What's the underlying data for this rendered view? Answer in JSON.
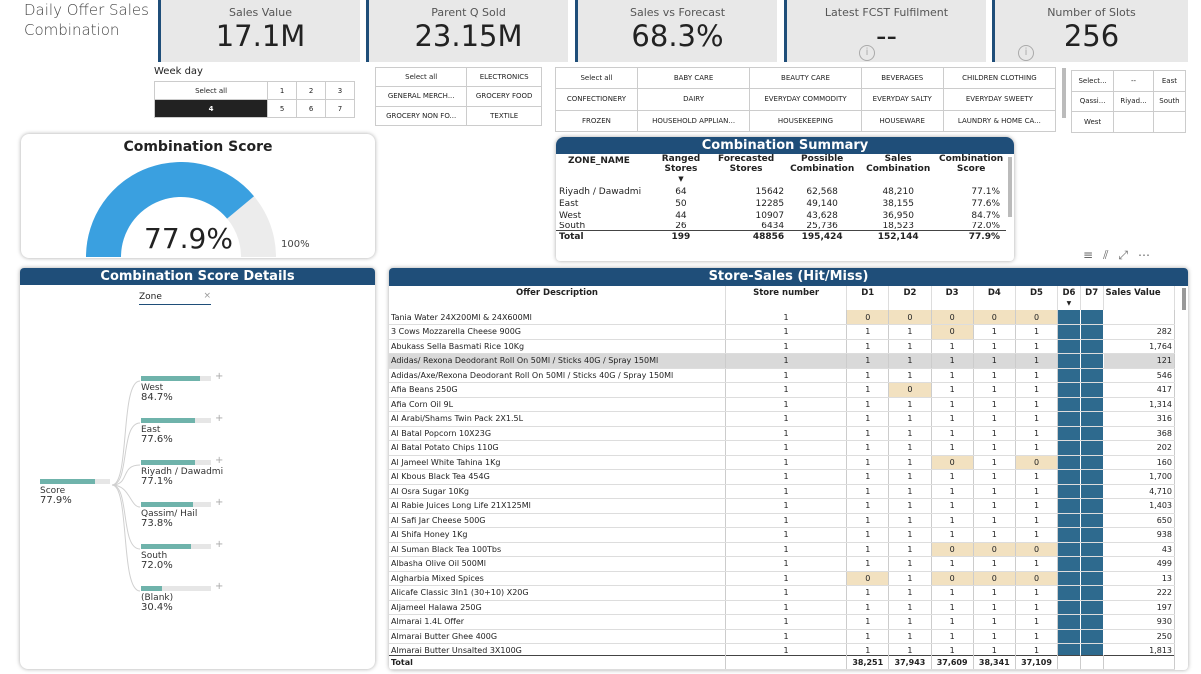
{
  "page": {
    "title": "Daily Offer Sales Combination"
  },
  "kpis": [
    {
      "label": "Sales Value",
      "value": "17.1M"
    },
    {
      "label": "Parent Q Sold",
      "value": "23.15M"
    },
    {
      "label": "Sales vs Forecast",
      "value": "68.3%"
    },
    {
      "label": "Latest FCST Fulfilment",
      "value": "--"
    },
    {
      "label": "Number of Slots",
      "value": "256"
    }
  ],
  "weekday": {
    "label": "Week day",
    "row1": [
      "Select all",
      "1",
      "2",
      "3"
    ],
    "row2": [
      "4",
      "5",
      "6",
      "7"
    ]
  },
  "dept": {
    "rows": [
      [
        "Select all",
        "ELECTRONICS"
      ],
      [
        "GENERAL MERCH...",
        "GROCERY FOOD"
      ],
      [
        "GROCERY NON FO...",
        "TEXTILE"
      ]
    ]
  },
  "category": {
    "rows": [
      [
        "Select all",
        "BABY CARE",
        "BEAUTY CARE",
        "BEVERAGES",
        "CHILDREN CLOTHING"
      ],
      [
        "CONFECTIONERY",
        "DAIRY",
        "EVERYDAY COMMODITY",
        "EVERYDAY SALTY",
        "EVERYDAY SWEETY"
      ],
      [
        "FROZEN",
        "HOUSEHOLD APPLIAN...",
        "HOUSEKEEPING",
        "HOUSEWARE",
        "LAUNDRY & HOME CA..."
      ]
    ]
  },
  "zone_slicer": {
    "rows": [
      [
        "Select...",
        "--",
        "East"
      ],
      [
        "Qassi...",
        "Riyad...",
        "South"
      ],
      [
        "West",
        "",
        ""
      ]
    ]
  },
  "gauge": {
    "title": "Combination Score",
    "value": "77.9%",
    "max_label": "100%",
    "fraction": 0.779,
    "fill": "#3aa0e0",
    "track": "#ececec"
  },
  "summary": {
    "title": "Combination Summary",
    "headers": [
      "ZONE_NAME",
      "Ranged Stores",
      "Forecasted Stores",
      "Possible Combination",
      "Sales Combination",
      "Combination Score"
    ],
    "rows": [
      [
        "Riyadh / Dawadmi",
        "64",
        "15642",
        "62,568",
        "48,210",
        "77.1%"
      ],
      [
        "East",
        "50",
        "12285",
        "49,140",
        "38,155",
        "77.6%"
      ],
      [
        "West",
        "44",
        "10907",
        "43,628",
        "36,950",
        "84.7%"
      ],
      [
        "South",
        "26",
        "6434",
        "25,736",
        "18,523",
        "72.0%"
      ]
    ],
    "total": [
      "Total",
      "199",
      "48856",
      "195,424",
      "152,144",
      "77.9%"
    ]
  },
  "tree": {
    "title": "Combination Score Details",
    "filter": "Zone",
    "root": {
      "label": "Score",
      "value": "77.9%",
      "fraction": 0.779
    },
    "nodes": [
      {
        "label": "West",
        "value": "84.7%",
        "fraction": 0.847
      },
      {
        "label": "East",
        "value": "77.6%",
        "fraction": 0.776
      },
      {
        "label": "Riyadh / Dawadmi",
        "value": "77.1%",
        "fraction": 0.771
      },
      {
        "label": "Qassim/ Hail",
        "value": "73.8%",
        "fraction": 0.738
      },
      {
        "label": "South",
        "value": "72.0%",
        "fraction": 0.72
      },
      {
        "label": "(Blank)",
        "value": "30.4%",
        "fraction": 0.304
      }
    ]
  },
  "store_sales": {
    "title": "Store-Sales (Hit/Miss)",
    "headers": [
      "Offer Description",
      "Store number",
      "D1",
      "D2",
      "D3",
      "D4",
      "D5",
      "D6",
      "D7",
      "Sales Value"
    ],
    "rows": [
      [
        "Tania Water 24X200Ml & 24X600Ml",
        "1",
        "0",
        "0",
        "0",
        "0",
        "0",
        ""
      ],
      [
        "3 Cows Mozzarella Cheese 900G",
        "1",
        "1",
        "1",
        "0",
        "1",
        "1",
        "282"
      ],
      [
        "Abukass Sella Basmati Rice 10Kg",
        "1",
        "1",
        "1",
        "1",
        "1",
        "1",
        "1,764"
      ],
      [
        "Adidas/ Rexona Deodorant Roll On 50Ml / Sticks 40G / Spray 150Ml",
        "1",
        "1",
        "1",
        "1",
        "1",
        "1",
        "121"
      ],
      [
        "Adidas/Axe/Rexona Deodorant Roll On 50Ml / Sticks 40G / Spray 150Ml",
        "1",
        "1",
        "1",
        "1",
        "1",
        "1",
        "546"
      ],
      [
        "Afia Beans 250G",
        "1",
        "1",
        "0",
        "1",
        "1",
        "1",
        "417"
      ],
      [
        "Afia Corn Oil 9L",
        "1",
        "1",
        "1",
        "1",
        "1",
        "1",
        "1,314"
      ],
      [
        "Al Arabi/Shams Twin Pack 2X1.5L",
        "1",
        "1",
        "1",
        "1",
        "1",
        "1",
        "316"
      ],
      [
        "Al Batal Popcorn 10X23G",
        "1",
        "1",
        "1",
        "1",
        "1",
        "1",
        "368"
      ],
      [
        "Al Batal Potato Chips 110G",
        "1",
        "1",
        "1",
        "1",
        "1",
        "1",
        "202"
      ],
      [
        "Al Jameel White Tahina 1Kg",
        "1",
        "1",
        "1",
        "0",
        "1",
        "0",
        "160"
      ],
      [
        "Al Kbous Black Tea 454G",
        "1",
        "1",
        "1",
        "1",
        "1",
        "1",
        "1,700"
      ],
      [
        "Al Osra Sugar 10Kg",
        "1",
        "1",
        "1",
        "1",
        "1",
        "1",
        "4,710"
      ],
      [
        "Al Rabie Juices Long Life 21X125Ml",
        "1",
        "1",
        "1",
        "1",
        "1",
        "1",
        "1,403"
      ],
      [
        "Al Safi Jar Cheese 500G",
        "1",
        "1",
        "1",
        "1",
        "1",
        "1",
        "650"
      ],
      [
        "Al Shifa Honey 1Kg",
        "1",
        "1",
        "1",
        "1",
        "1",
        "1",
        "938"
      ],
      [
        "Al Suman Black Tea 100Tbs",
        "1",
        "1",
        "1",
        "0",
        "0",
        "0",
        "43"
      ],
      [
        "Albasha Olive Oil 500Ml",
        "1",
        "1",
        "1",
        "1",
        "1",
        "1",
        "499"
      ],
      [
        "Algharbia Mixed Spices",
        "1",
        "0",
        "1",
        "0",
        "0",
        "0",
        "13"
      ],
      [
        "Alicafe Classic 3In1 (30+10) X20G",
        "1",
        "1",
        "1",
        "1",
        "1",
        "1",
        "222"
      ],
      [
        "Aljameel Halawa 250G",
        "1",
        "1",
        "1",
        "1",
        "1",
        "1",
        "197"
      ],
      [
        "Almarai 1.4L Offer",
        "1",
        "1",
        "1",
        "1",
        "1",
        "1",
        "930"
      ],
      [
        "Almarai Butter Ghee 400G",
        "1",
        "1",
        "1",
        "1",
        "1",
        "1",
        "250"
      ],
      [
        "Almarai Butter Unsalted 3X100G",
        "1",
        "1",
        "1",
        "1",
        "1",
        "1",
        "1,813"
      ]
    ],
    "total": [
      "Total",
      "",
      "38,251",
      "37,943",
      "37,609",
      "38,341",
      "37,109",
      "",
      ""
    ]
  },
  "colors": {
    "accent": "#1f4e79",
    "highlight": "#f2e1c0",
    "d_col": "#2e6a8e"
  }
}
